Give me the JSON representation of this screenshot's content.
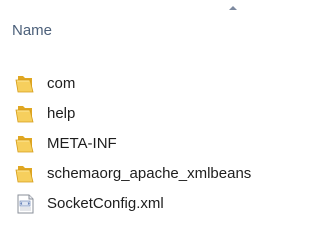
{
  "header": {
    "column_name": "Name",
    "sort_direction": "ascending"
  },
  "items": [
    {
      "label": "com",
      "type": "folder",
      "icon": "folder-icon"
    },
    {
      "label": "help",
      "type": "folder",
      "icon": "folder-icon"
    },
    {
      "label": "META-INF",
      "type": "folder",
      "icon": "folder-icon"
    },
    {
      "label": "schemaorg_apache_xmlbeans",
      "type": "folder",
      "icon": "folder-icon"
    },
    {
      "label": "SocketConfig.xml",
      "type": "file",
      "icon": "xml-file-icon"
    }
  ],
  "colors": {
    "header_text": "#4c607a",
    "item_text": "#1e1e1e",
    "folder_yellow": "#f2c14e"
  }
}
